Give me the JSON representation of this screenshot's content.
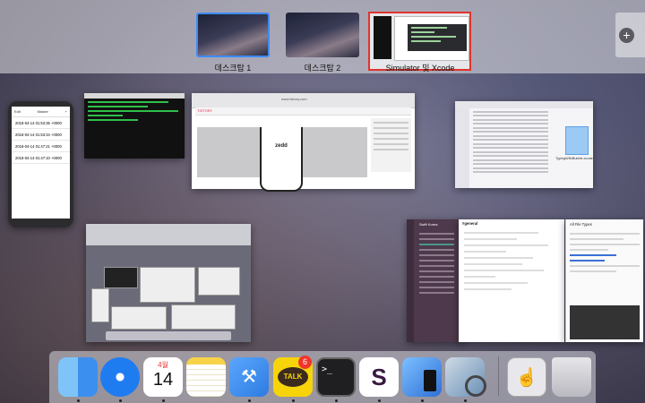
{
  "spaces": [
    {
      "label": "데스크탑 1",
      "selected": true
    },
    {
      "label": "데스크탑 2",
      "selected": false
    },
    {
      "label": "Simulator 및 Xcode",
      "highlighted": true
    }
  ],
  "add_space_icon": "plus-icon",
  "windows": {
    "simulator": {
      "back": "Edit",
      "title": "Master",
      "rows": [
        "2018-04-14 01:53:35 +0000",
        "2018-04-14 01:53:34 +0000",
        "2018-04-14 01:47:21 +0000",
        "2018-04-14 01:47:10 +0000"
      ]
    },
    "browser": {
      "url": "www.tistory.com",
      "brand": "TISTORY",
      "device_text": "zedd"
    },
    "finder": {
      "file_name": "TypingWithBubble.xcode"
    },
    "slack": {
      "workspace": "Swift Korea",
      "channel": "#general"
    },
    "slack_files": {
      "title": "All File Types"
    }
  },
  "dock": {
    "apps": [
      {
        "name": "finder-icon",
        "color": "#3b8fef"
      },
      {
        "name": "safari-icon",
        "color": "#1e7cf0"
      },
      {
        "name": "calendar-icon",
        "month": "4월",
        "day": "14"
      },
      {
        "name": "notes-icon",
        "color": "#f7d34a"
      },
      {
        "name": "xcode-icon",
        "color": "#2d7be0"
      },
      {
        "name": "kakaotalk-icon",
        "label": "TALK",
        "badge": "6"
      },
      {
        "name": "terminal-icon",
        "prompt": ">_"
      },
      {
        "name": "slack-icon",
        "label": "S"
      },
      {
        "name": "simulator-icon",
        "color": "#3d8fe8"
      },
      {
        "name": "preview-icon",
        "color": "#6a8fb5"
      },
      {
        "name": "downloads-icon",
        "color": "#e8e8ec"
      },
      {
        "name": "trash-icon",
        "color": "#cfcfd4"
      }
    ]
  }
}
